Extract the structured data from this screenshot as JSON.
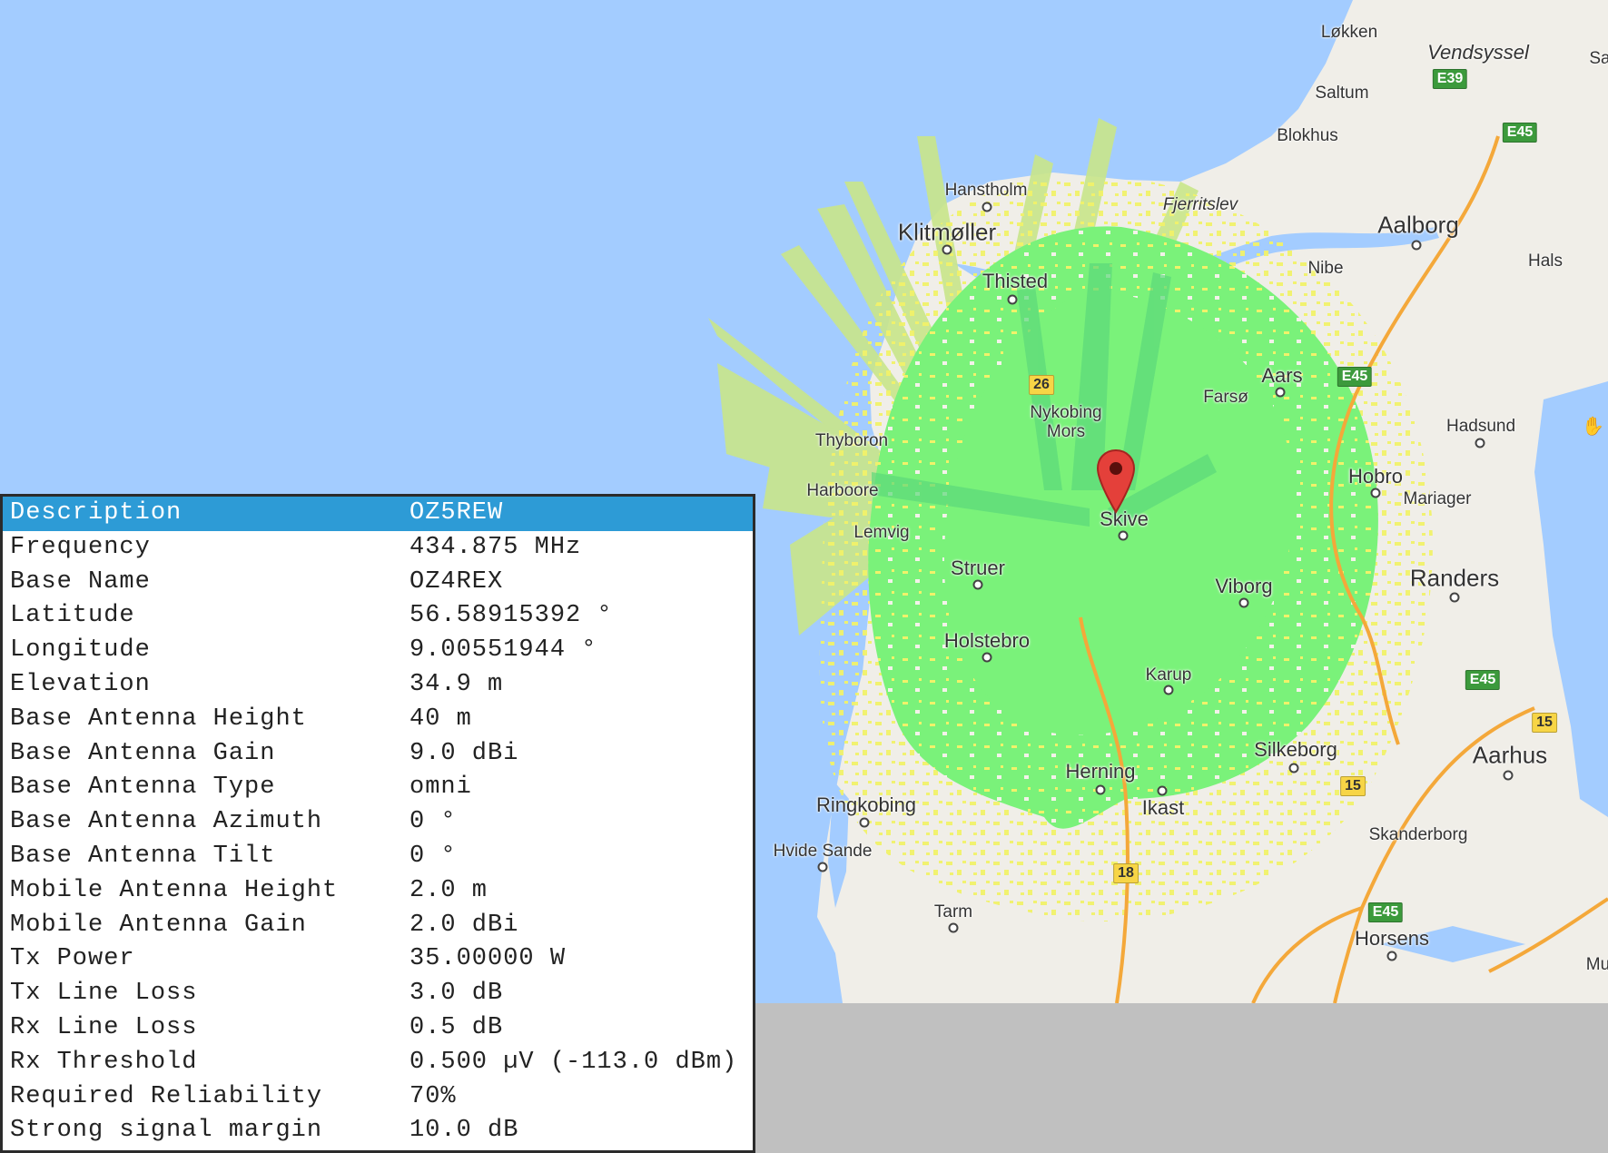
{
  "map": {
    "marker": "map-pin-icon",
    "cursor": "hand-pan-cursor-icon",
    "colors": {
      "sea": "#a3ccff",
      "land": "#f0eee8",
      "coverage_strong": "#7af27a",
      "coverage_weak": "#f1f26a",
      "coverage_sea": "#c9e68a",
      "pin": "#e4403a"
    },
    "place_labels": [
      {
        "name": "Løkken",
        "size": "sm",
        "dot": false
      },
      {
        "name": "Vendsyssel",
        "size": "mid",
        "italic": true,
        "dot": false
      },
      {
        "name": "Saltum",
        "size": "sm",
        "dot": false
      },
      {
        "name": "Blokhus",
        "size": "sm",
        "dot": false
      },
      {
        "name": "Hanstholm",
        "size": "sm",
        "dot": true
      },
      {
        "name": "Fjerritslev",
        "size": "sm",
        "dot": true
      },
      {
        "name": "Klitmøller",
        "size": "big",
        "dot": true
      },
      {
        "name": "Aalborg",
        "size": "big",
        "dot": true
      },
      {
        "name": "Thisted",
        "size": "mid",
        "dot": true
      },
      {
        "name": "Nibe",
        "size": "sm",
        "dot": true
      },
      {
        "name": "Hals",
        "size": "sm",
        "dot": true
      },
      {
        "name": "Aars",
        "size": "mid",
        "dot": true
      },
      {
        "name": "Farsø",
        "size": "sm",
        "dot": true
      },
      {
        "name": "Nykobing Mors",
        "size": "sm",
        "dot": true
      },
      {
        "name": "Hadsund",
        "size": "sm",
        "dot": true
      },
      {
        "name": "Thyboron",
        "size": "sm",
        "dot": true
      },
      {
        "name": "Hobro",
        "size": "mid",
        "dot": true
      },
      {
        "name": "Mariager",
        "size": "sm",
        "dot": true
      },
      {
        "name": "Harboore",
        "size": "sm",
        "dot": true
      },
      {
        "name": "Skive",
        "size": "mid",
        "dot": true
      },
      {
        "name": "Lemvig",
        "size": "sm",
        "dot": true
      },
      {
        "name": "Struer",
        "size": "mid",
        "dot": true
      },
      {
        "name": "Viborg",
        "size": "mid",
        "dot": true
      },
      {
        "name": "Randers",
        "size": "big",
        "dot": true
      },
      {
        "name": "Holstebro",
        "size": "mid",
        "dot": true
      },
      {
        "name": "Karup",
        "size": "sm",
        "dot": true
      },
      {
        "name": "Silkeborg",
        "size": "mid",
        "dot": true
      },
      {
        "name": "Aarhus",
        "size": "big",
        "dot": true
      },
      {
        "name": "Herning",
        "size": "mid",
        "dot": true
      },
      {
        "name": "Ikast",
        "size": "mid",
        "dot": true
      },
      {
        "name": "Ringkobing",
        "size": "mid",
        "dot": true
      },
      {
        "name": "Skanderborg",
        "size": "sm",
        "dot": true
      },
      {
        "name": "Hvide Sande",
        "size": "sm",
        "dot": true
      },
      {
        "name": "Tarm",
        "size": "sm",
        "dot": true
      },
      {
        "name": "Horsens",
        "size": "mid",
        "dot": true
      },
      {
        "name": "Sa",
        "size": "sm",
        "dot": false
      },
      {
        "name": "Mu",
        "size": "sm",
        "dot": false
      }
    ],
    "road_shields": [
      {
        "label": "E39",
        "kind": "e"
      },
      {
        "label": "E45",
        "kind": "e"
      },
      {
        "label": "E45",
        "kind": "e"
      },
      {
        "label": "26",
        "kind": "n"
      },
      {
        "label": "E45",
        "kind": "e"
      },
      {
        "label": "15",
        "kind": "n"
      },
      {
        "label": "15",
        "kind": "n"
      },
      {
        "label": "18",
        "kind": "n"
      },
      {
        "label": "E45",
        "kind": "e"
      }
    ]
  },
  "info_table": {
    "rows": [
      {
        "label": "Description",
        "value": "OZ5REW"
      },
      {
        "label": "Frequency",
        "value": "434.875 MHz"
      },
      {
        "label": "Base Name",
        "value": "OZ4REX"
      },
      {
        "label": "Latitude",
        "value": "56.58915392 °"
      },
      {
        "label": "Longitude",
        "value": "9.00551944 °"
      },
      {
        "label": "Elevation",
        "value": "34.9 m"
      },
      {
        "label": "Base Antenna Height",
        "value": "40 m"
      },
      {
        "label": "Base Antenna Gain",
        "value": "9.0 dBi"
      },
      {
        "label": "Base Antenna Type",
        "value": "omni"
      },
      {
        "label": "Base Antenna Azimuth",
        "value": "0 °"
      },
      {
        "label": "Base Antenna Tilt",
        "value": "0 °"
      },
      {
        "label": "Mobile Antenna Height",
        "value": "2.0 m"
      },
      {
        "label": "Mobile Antenna Gain",
        "value": "2.0 dBi"
      },
      {
        "label": "Tx Power",
        "value": "35.00000 W"
      },
      {
        "label": "Tx Line Loss",
        "value": "3.0 dB"
      },
      {
        "label": "Rx Line Loss",
        "value": "0.5 dB"
      },
      {
        "label": "Rx Threshold",
        "value": "0.500 µV (-113.0 dBm)"
      },
      {
        "label": "Required Reliability",
        "value": "70%"
      },
      {
        "label": "Strong signal margin",
        "value": "10.0 dB"
      }
    ]
  }
}
